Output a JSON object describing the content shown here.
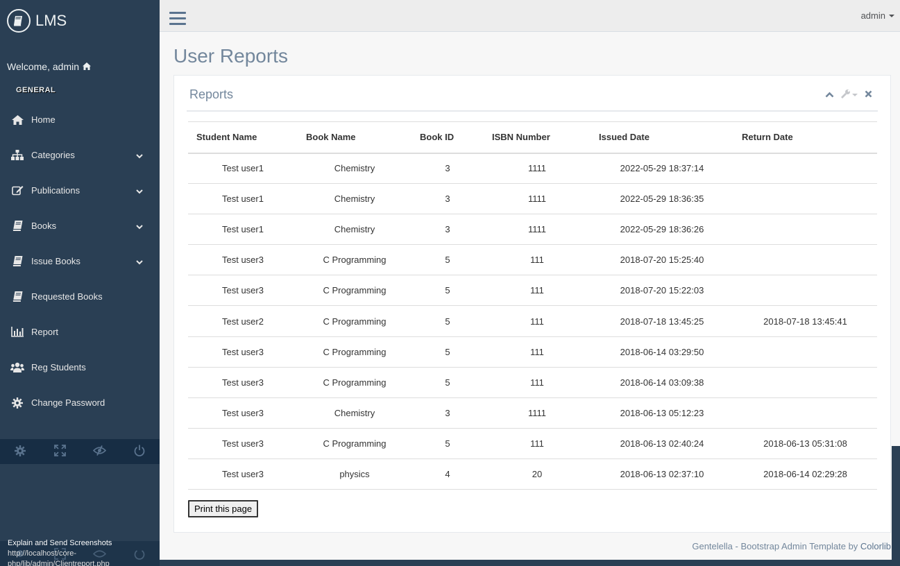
{
  "brand": {
    "title": "LMS"
  },
  "welcome": {
    "text": "Welcome, admin"
  },
  "sidebar": {
    "section_title": "GENERAL",
    "items": [
      {
        "label": "Home",
        "icon": "home-icon",
        "has_submenu": false
      },
      {
        "label": "Categories",
        "icon": "sitemap-icon",
        "has_submenu": true
      },
      {
        "label": "Publications",
        "icon": "edit-icon",
        "has_submenu": true
      },
      {
        "label": "Books",
        "icon": "book-icon",
        "has_submenu": true
      },
      {
        "label": "Issue Books",
        "icon": "book-icon",
        "has_submenu": true
      },
      {
        "label": "Requested Books",
        "icon": "book-icon",
        "has_submenu": false
      },
      {
        "label": "Report",
        "icon": "bar-chart-icon",
        "has_submenu": false
      },
      {
        "label": "Reg Students",
        "icon": "users-icon",
        "has_submenu": false
      },
      {
        "label": "Change Password",
        "icon": "gear-icon",
        "has_submenu": false
      }
    ],
    "footer_buttons": [
      "settings-icon",
      "fullscreen-icon",
      "eye-slash-icon",
      "power-icon"
    ]
  },
  "topnav": {
    "user": "admin"
  },
  "page": {
    "title": "User Reports"
  },
  "panel": {
    "title": "Reports"
  },
  "table": {
    "headers": [
      "Student Name",
      "Book Name",
      "Book ID",
      "ISBN Number",
      "Issued Date",
      "Return Date"
    ],
    "rows": [
      [
        "Test user1",
        "Chemistry",
        "3",
        "1111",
        "2022-05-29 18:37:14",
        ""
      ],
      [
        "Test user1",
        "Chemistry",
        "3",
        "1111",
        "2022-05-29 18:36:35",
        ""
      ],
      [
        "Test user1",
        "Chemistry",
        "3",
        "1111",
        "2022-05-29 18:36:26",
        ""
      ],
      [
        "Test user3",
        "C Programming",
        "5",
        "111",
        "2018-07-20 15:25:40",
        ""
      ],
      [
        "Test user3",
        "C Programming",
        "5",
        "111",
        "2018-07-20 15:22:03",
        ""
      ],
      [
        "Test user2",
        "C Programming",
        "5",
        "111",
        "2018-07-18 13:45:25",
        "2018-07-18 13:45:41"
      ],
      [
        "Test user3",
        "C Programming",
        "5",
        "111",
        "2018-06-14 03:29:50",
        ""
      ],
      [
        "Test user3",
        "C Programming",
        "5",
        "111",
        "2018-06-14 03:09:38",
        ""
      ],
      [
        "Test user3",
        "Chemistry",
        "3",
        "1111",
        "2018-06-13 05:12:23",
        ""
      ],
      [
        "Test user3",
        "C Programming",
        "5",
        "111",
        "2018-06-13 02:40:24",
        "2018-06-13 05:31:08"
      ],
      [
        "Test user3",
        "physics",
        "4",
        "20",
        "2018-06-13 02:37:10",
        "2018-06-14 02:29:28"
      ]
    ]
  },
  "print_button": {
    "label": "Print this page"
  },
  "footer": {
    "text": "Gentelella - Bootstrap Admin Template by ",
    "link": "Colorlib"
  },
  "status_bar": {
    "line1": "Explain and Send Screenshots",
    "url": "http://localhost/core-php/lib/admin/Clientreport.php"
  },
  "colors": {
    "sidebar_bg": "#2A3F54",
    "sidebar_footer_bg": "#172D44",
    "main_bg": "#F7F7F7",
    "text": "#73879C"
  }
}
